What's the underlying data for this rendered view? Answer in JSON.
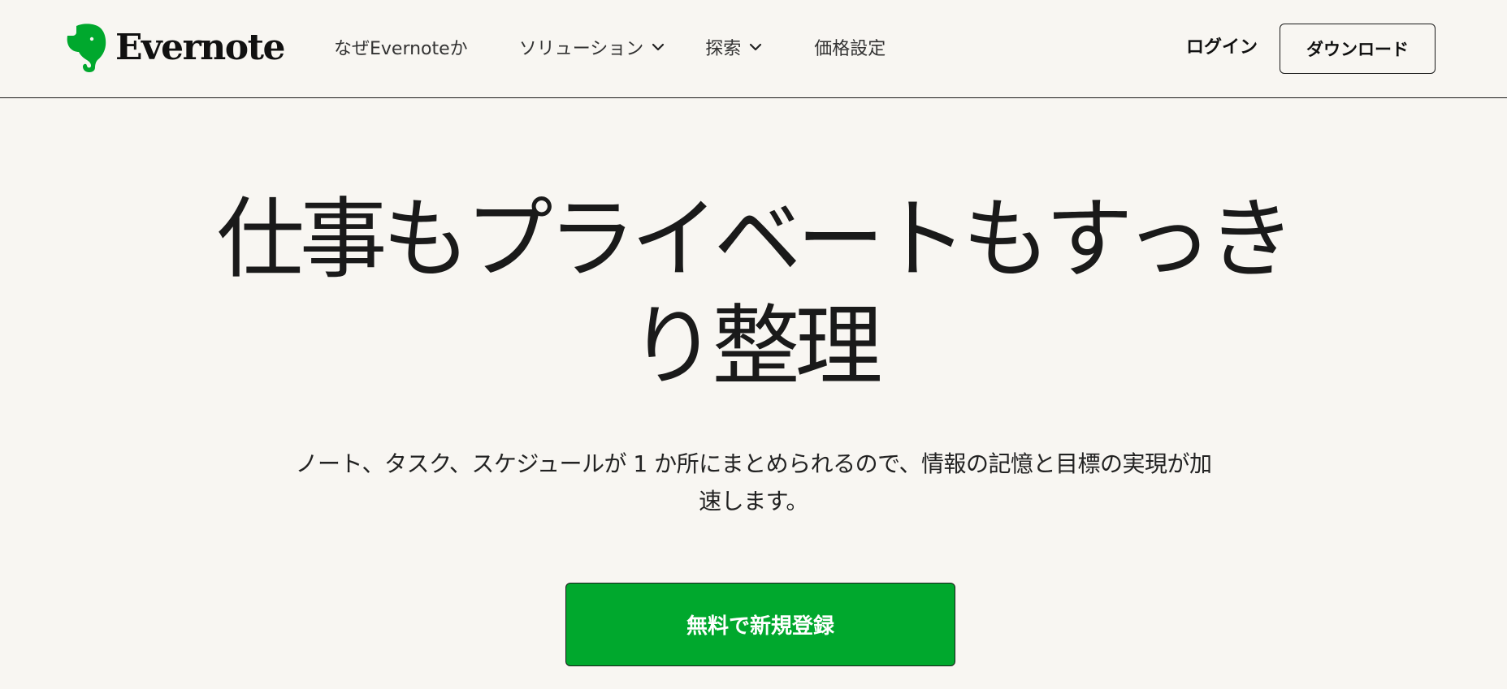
{
  "brand": {
    "name": "Evernote",
    "logo_icon": "elephant-logo-icon",
    "logo_color": "#00a82d"
  },
  "nav": {
    "why": "なぜEvernoteか",
    "solutions": "ソリューション",
    "explore": "探索",
    "pricing": "価格設定",
    "login": "ログイン",
    "download": "ダウンロード"
  },
  "hero": {
    "title_line1": "仕事もプライベートもすっき",
    "title_line2": "り整理",
    "subtitle_line1": "ノート、タスク、スケジュールが 1 か所にまとめられるので、情報の記憶と目標の実現が加",
    "subtitle_line2": "速します。",
    "cta": "無料で新規登録"
  },
  "colors": {
    "background": "#f8f6f2",
    "accent": "#00a82d",
    "text": "#1a1a1a"
  }
}
